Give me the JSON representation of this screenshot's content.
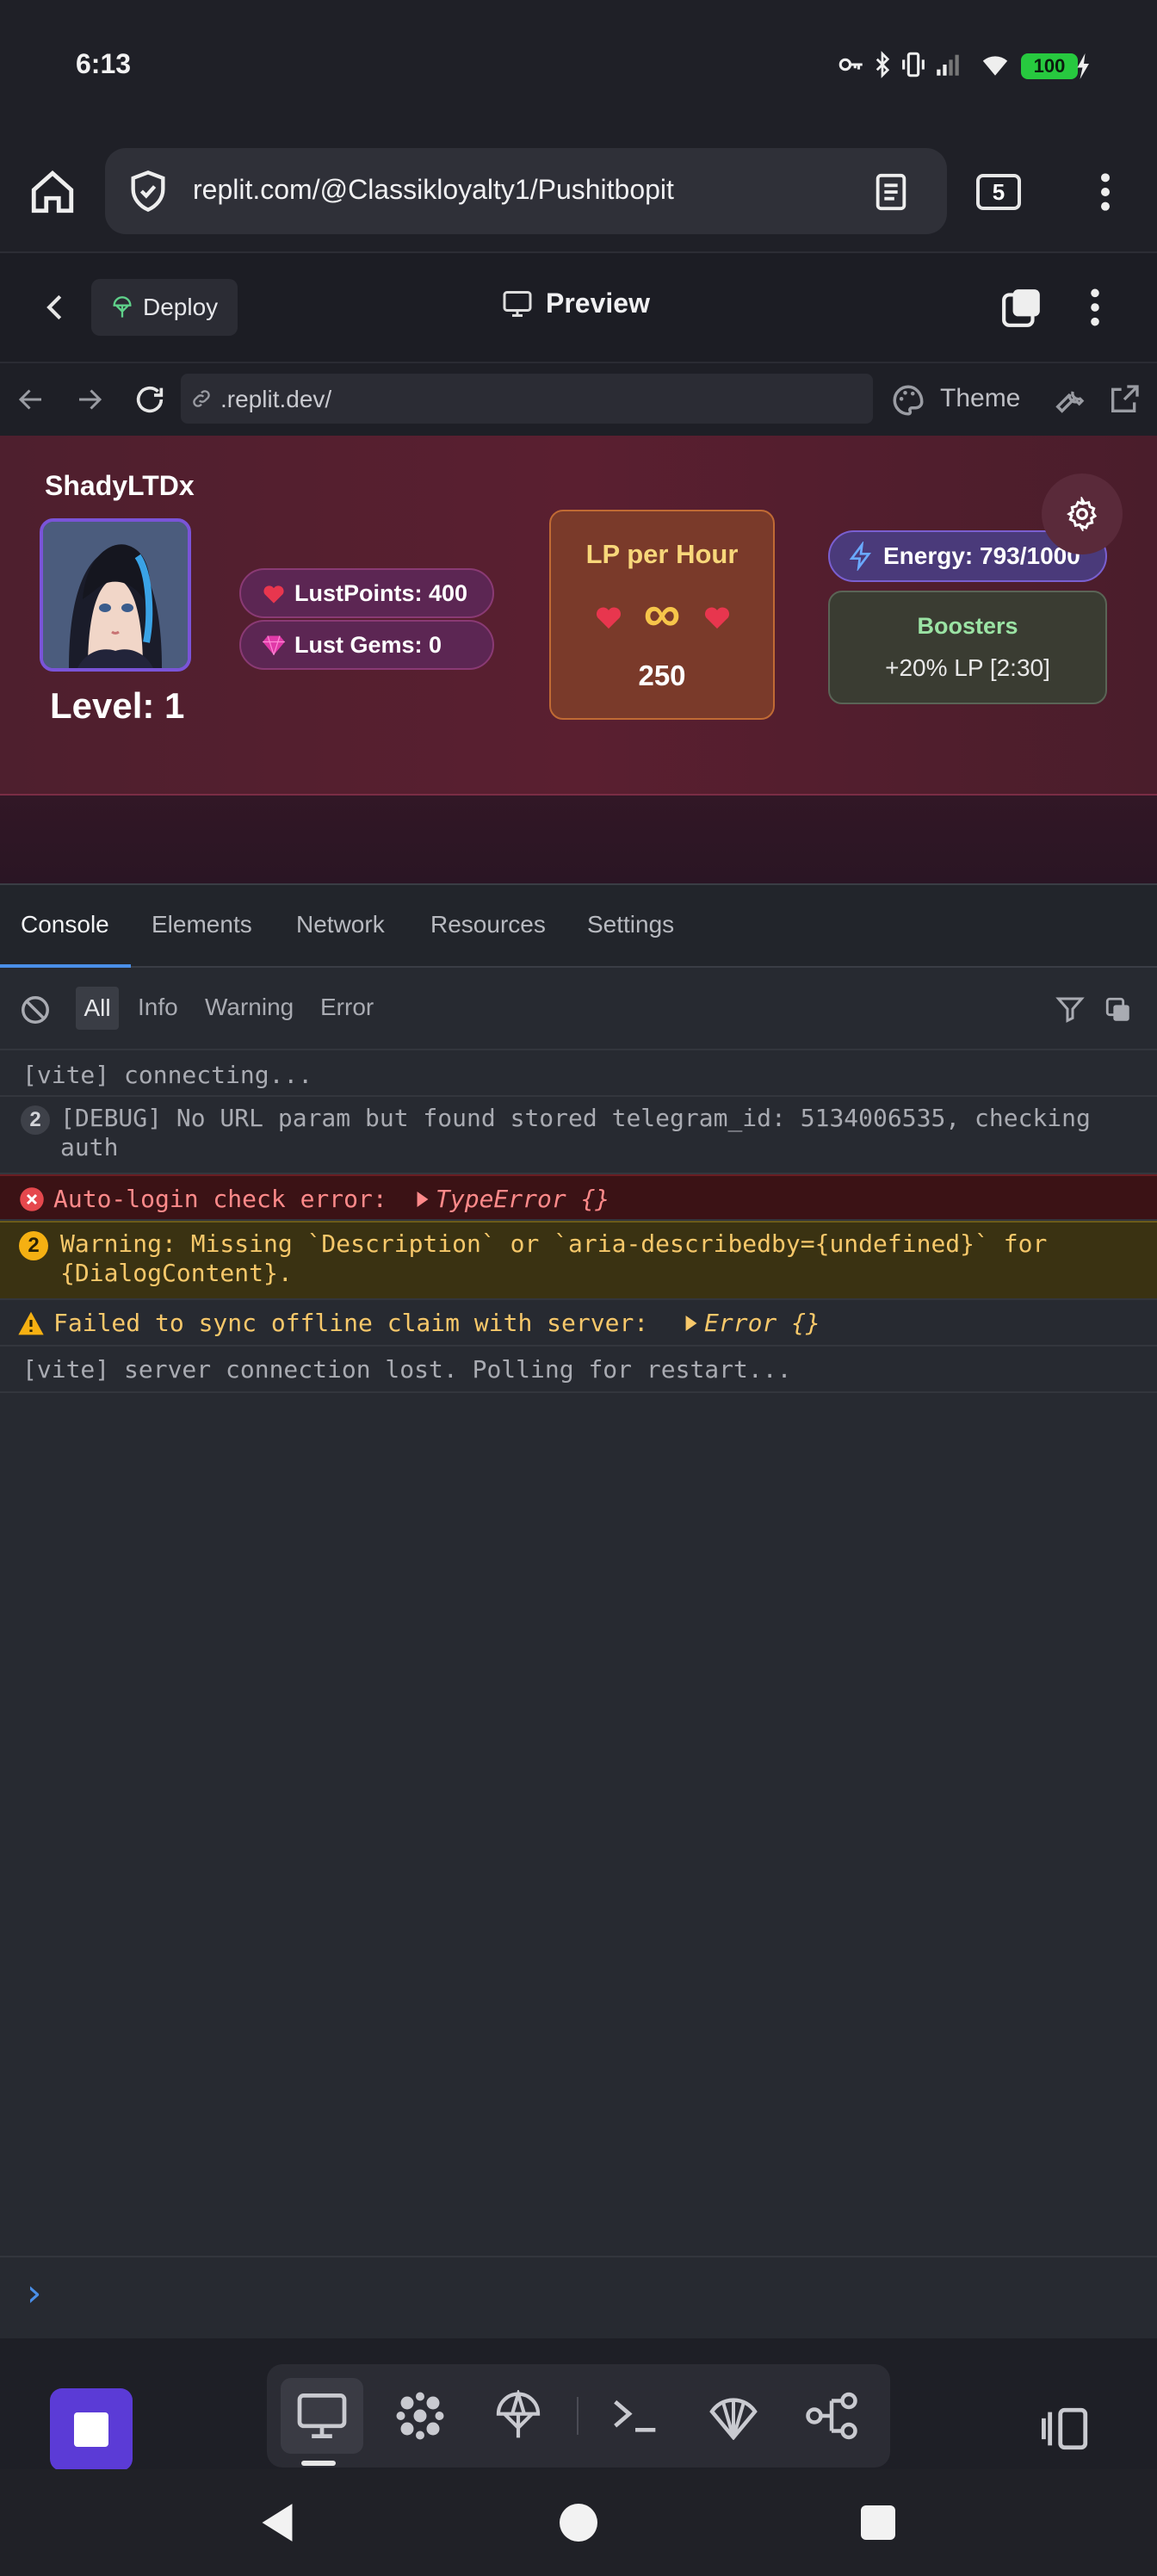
{
  "status_bar": {
    "time": "6:13",
    "battery": "100",
    "icons": [
      "key-icon",
      "bluetooth-icon",
      "vibrate-icon",
      "signal-icon",
      "wifi-icon",
      "battery-icon"
    ]
  },
  "browser": {
    "url": "replit.com/@Classikloyalty1/Pushitbopit",
    "tab_count": "5"
  },
  "replit_header": {
    "deploy_label": "Deploy",
    "preview_label": "Preview"
  },
  "webview": {
    "address": ".replit.dev/",
    "theme_label": "Theme"
  },
  "game": {
    "player_name": "ShadyLTDx",
    "level": "Level: 1",
    "lust_points": "LustPoints: 400",
    "lust_gems": "Lust Gems: 0",
    "lp_per_hour_title": "LP per Hour",
    "lp_per_hour_symbol": "∞",
    "lp_per_hour_value": "250",
    "energy": "Energy: 793/1000",
    "boosters_title": "Boosters",
    "boosters_value": "+20% LP [2:30]"
  },
  "devtools": {
    "tabs": [
      "Console",
      "Elements",
      "Network",
      "Resources",
      "Settings"
    ],
    "filters": [
      "All",
      "Info",
      "Warning",
      "Error"
    ],
    "logs": [
      {
        "type": "log",
        "text": "[vite] connecting..."
      },
      {
        "type": "log",
        "count": "2",
        "text": "[DEBUG] No URL param but found stored telegram_id: 5134006535, checking auth"
      },
      {
        "type": "error",
        "text": "Auto-login check error:",
        "object": "TypeError {}"
      },
      {
        "type": "warning",
        "count": "2",
        "text": "Warning: Missing `Description` or `aria-describedby={undefined}` for {DialogContent}."
      },
      {
        "type": "warning",
        "text": "Failed to sync offline claim with server:",
        "object": "Error {}"
      },
      {
        "type": "log",
        "text": "[vite] server connection lost. Polling for restart..."
      }
    ],
    "prompt": "›"
  },
  "colors": {
    "accent_blue": "#4a8fe8",
    "error_bg": "#3b1215",
    "warning_bg": "#3a3212",
    "stop_button": "#5b3bd6"
  }
}
